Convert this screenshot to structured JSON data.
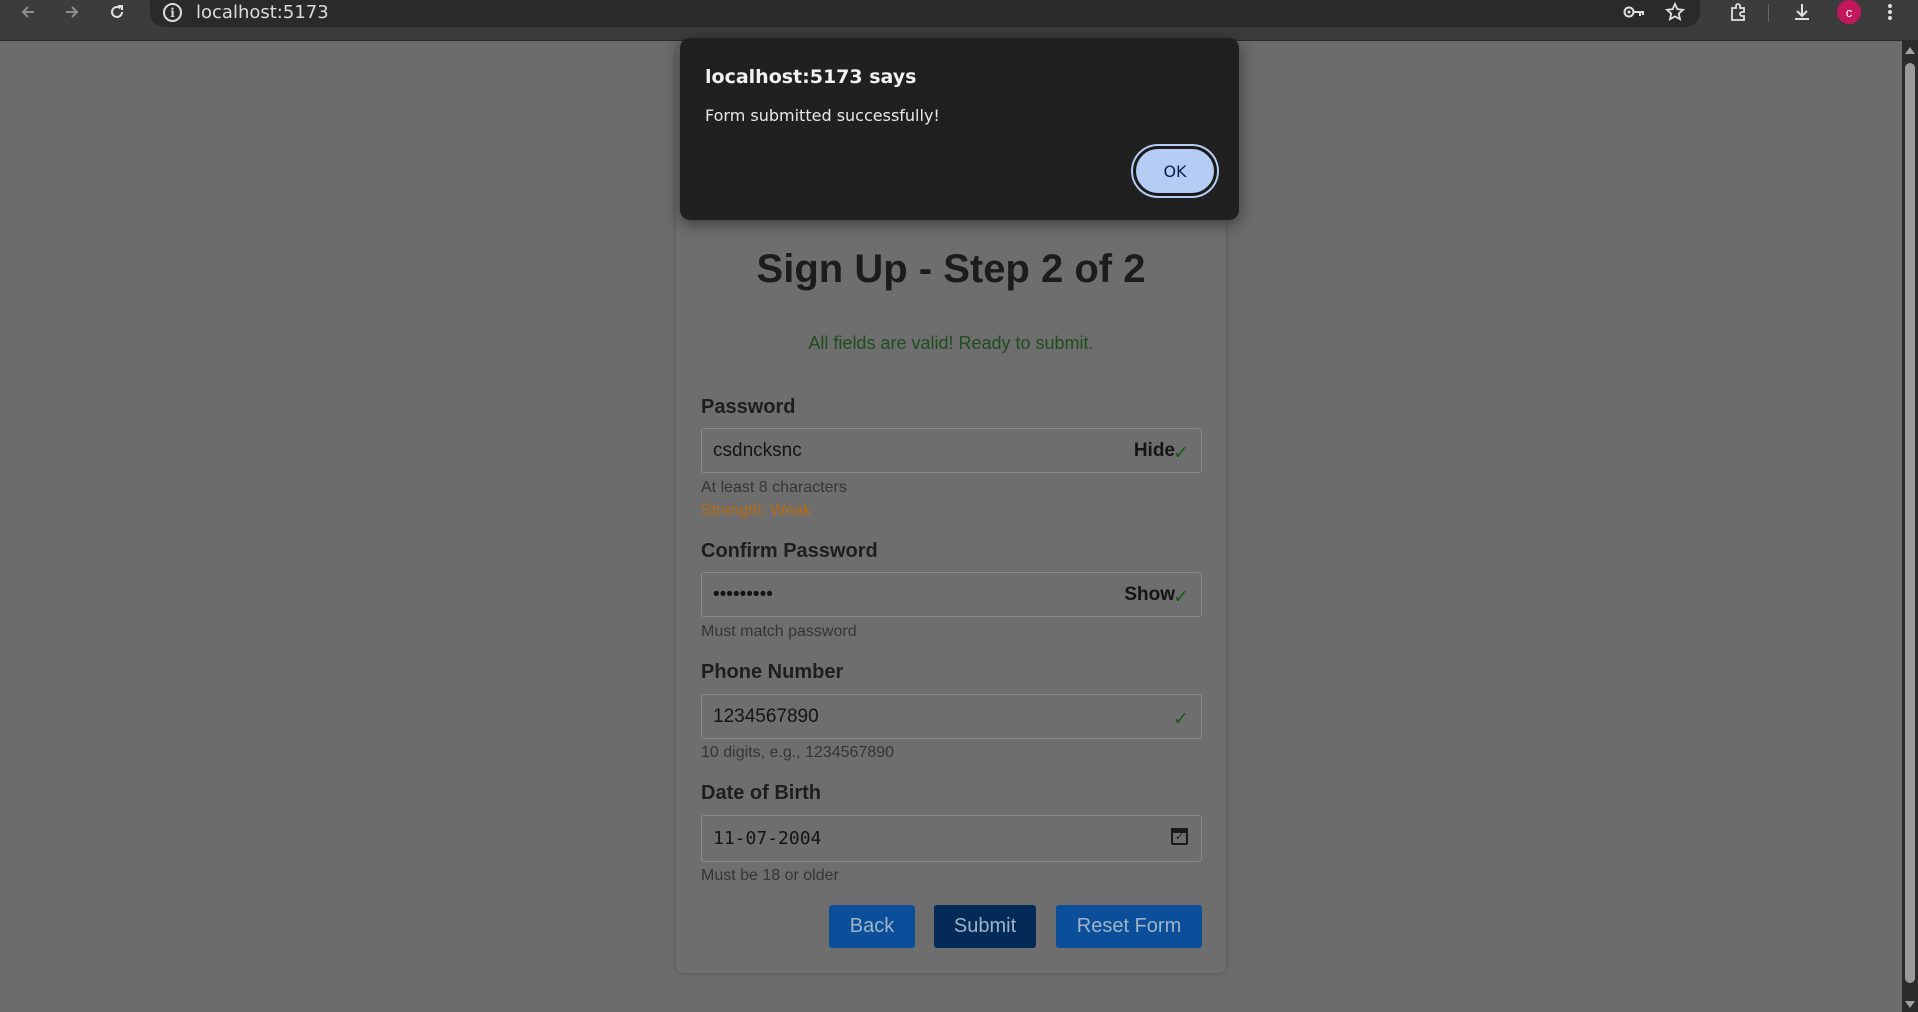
{
  "browser": {
    "url": "localhost:5173"
  },
  "form": {
    "title": "Sign Up - Step 2 of 2",
    "status_message": "All fields are valid! Ready to submit.",
    "password": {
      "label": "Password",
      "value": "csdncksnc",
      "toggle_label": "Hide",
      "hint": "At least 8 characters",
      "strength": "Strength: Weak"
    },
    "confirm_password": {
      "label": "Confirm Password",
      "value": "•••••••••",
      "toggle_label": "Show",
      "hint": "Must match password"
    },
    "phone": {
      "label": "Phone Number",
      "value": "1234567890",
      "hint": "10 digits, e.g., 1234567890"
    },
    "dob": {
      "label": "Date of Birth",
      "value": "11-07-2004",
      "hint": "Must be 18 or older"
    },
    "buttons": {
      "back": "Back",
      "submit": "Submit",
      "reset": "Reset Form"
    },
    "valid_check": "✓"
  },
  "dialog": {
    "title": "localhost:5173 says",
    "message": "Form submitted successfully!",
    "ok_label": "OK"
  },
  "colors": {
    "valid_green": "#1e4d1e",
    "strength_weak": "#b86a10",
    "primary_button": "#0b4f9a",
    "submit_button": "#042a58",
    "avatar": "#c2185b",
    "dialog_ok": "#b5cdf5"
  },
  "avatar_initial": "c"
}
